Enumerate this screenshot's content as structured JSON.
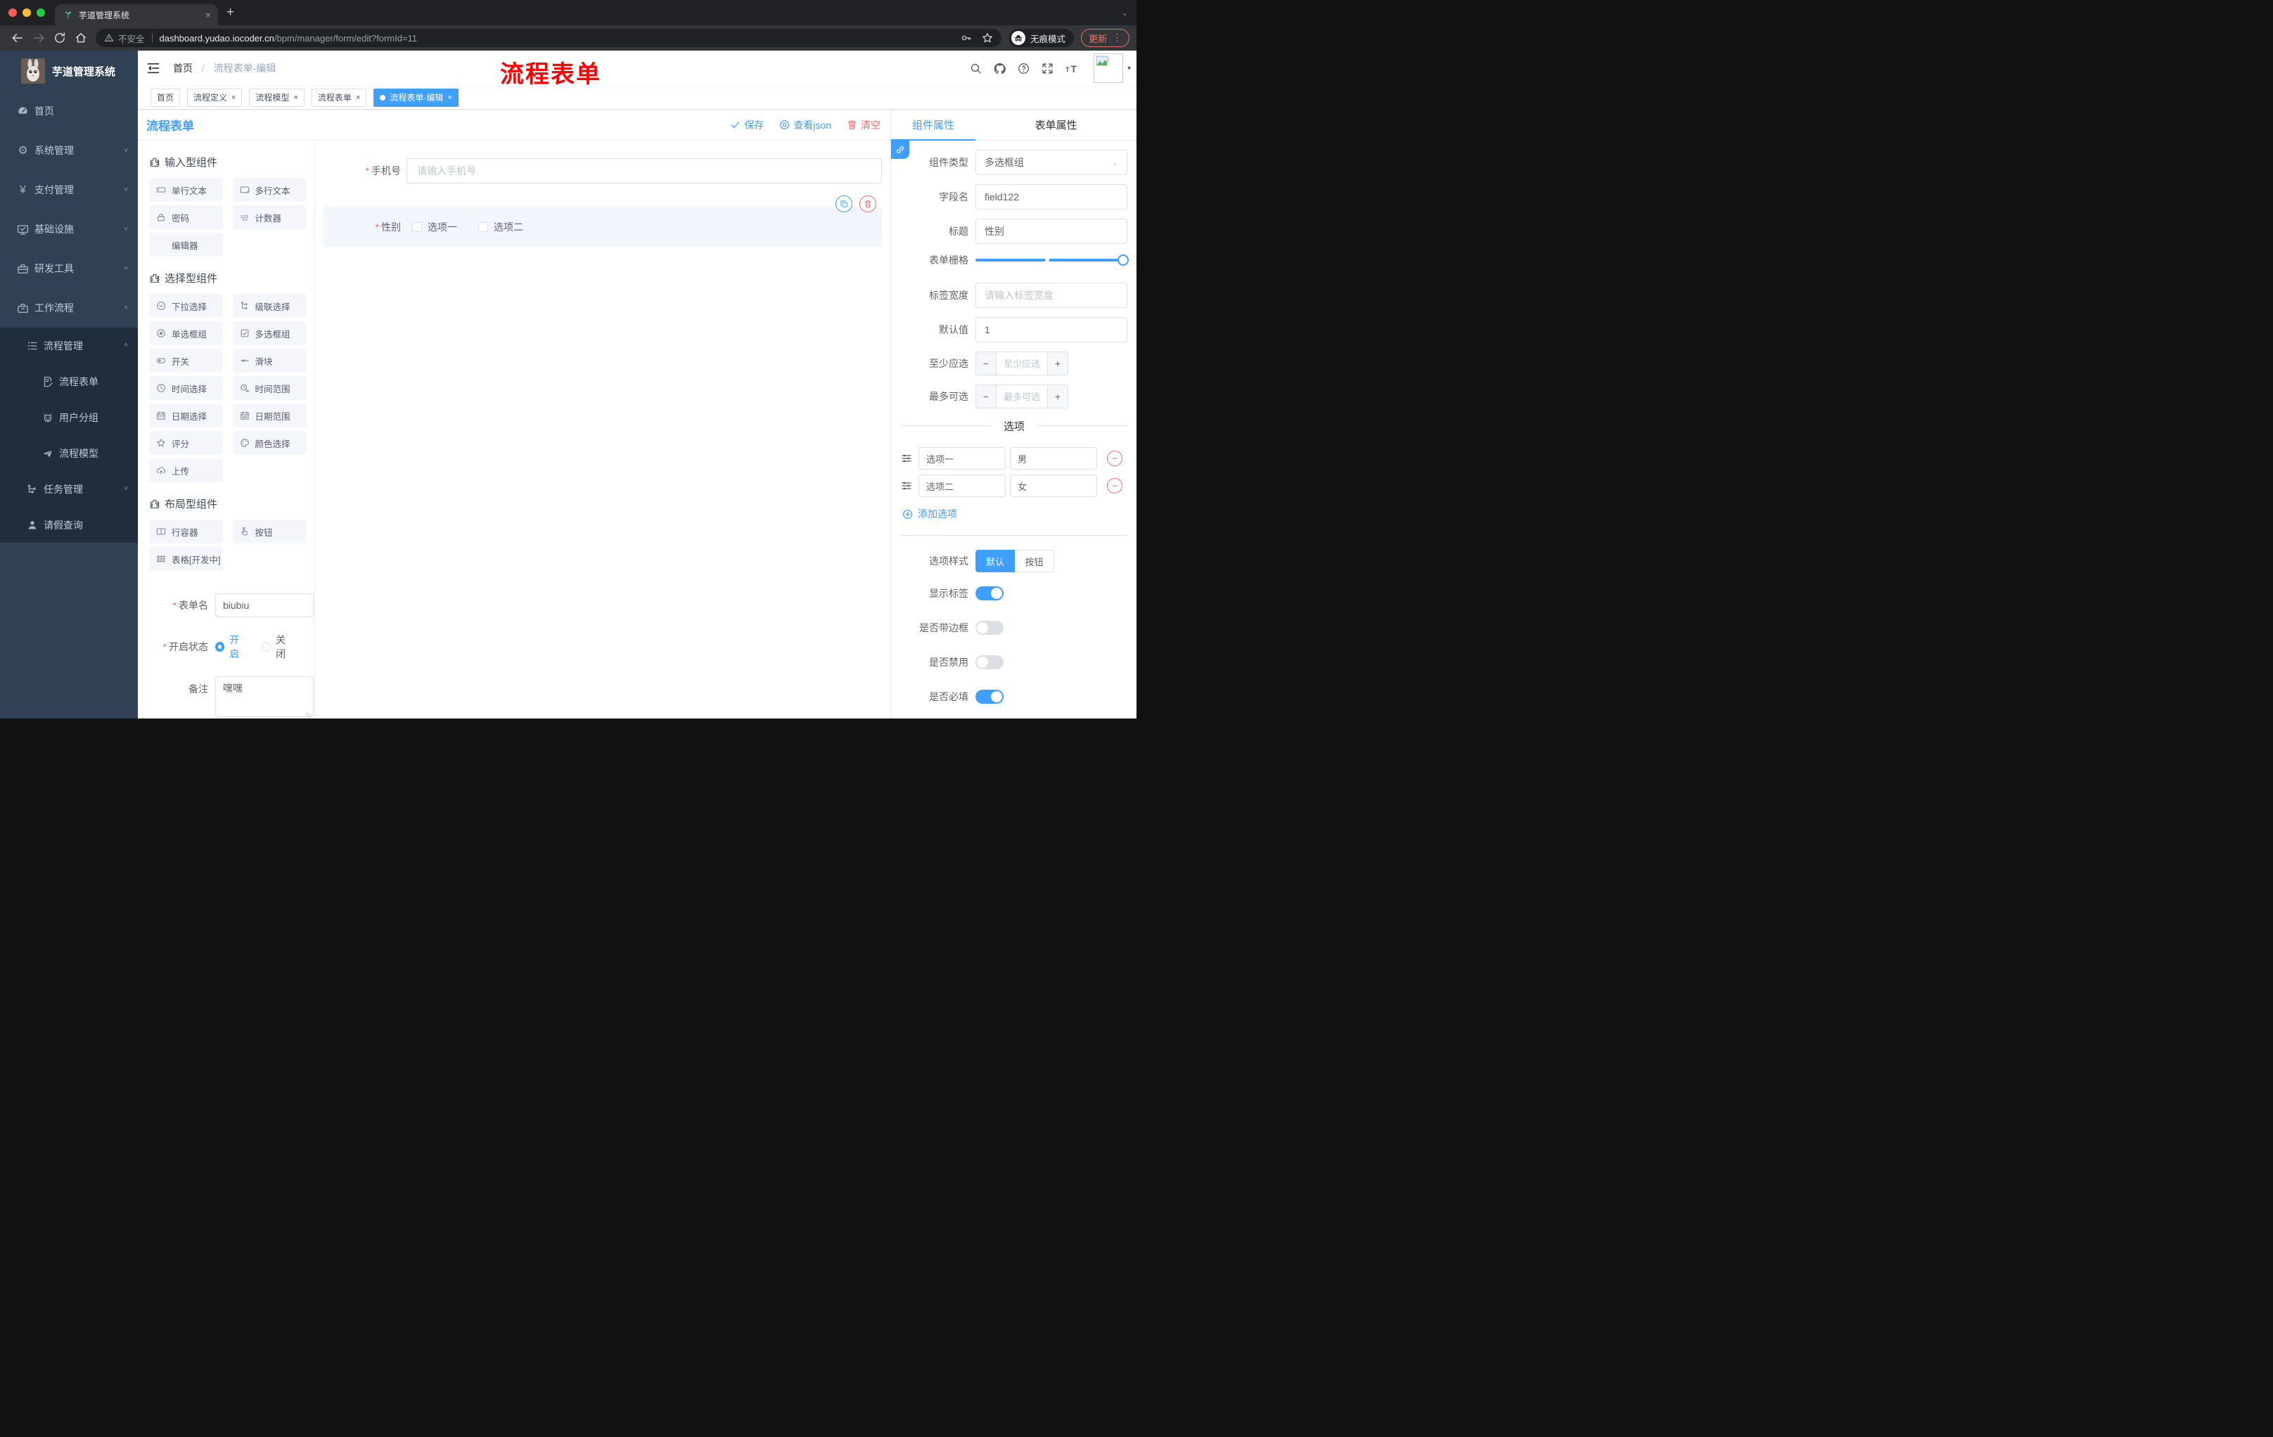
{
  "ui": {
    "close": "×",
    "plus": "+",
    "minus": "−",
    "kebab": "⋮",
    "caret": "▾",
    "strip_caret": "⌄",
    "slash": "/",
    "asterisk": "*",
    "sel_caret": "⌄"
  },
  "colors": {
    "accent": "#409eff",
    "danger": "#f56c6c",
    "sidebar_bg": "#304156",
    "submenu_bg": "#1f2d3d",
    "annotation": "#ff0000",
    "active_tag": "#409eff"
  },
  "browser": {
    "tab_title": "芋道管理系统",
    "security_label": "不安全",
    "url_host": "dashboard.yudao.iocoder.cn",
    "url_path": "/bpm/manager/form/edit?formId=11",
    "incognito_label": "无痕模式",
    "update_label": "更新"
  },
  "header": {
    "breadcrumb_home": "首页",
    "breadcrumb_current": "流程表单-编辑",
    "annotation": "流程表单"
  },
  "sidebar": {
    "logo_title": "芋道管理系统",
    "items": [
      {
        "label": "首页",
        "icon": "dashboard-icon"
      },
      {
        "label": "系统管理",
        "icon": "gear-icon"
      },
      {
        "label": "支付管理",
        "icon": "yen-icon"
      },
      {
        "label": "基础设施",
        "icon": "monitor-icon"
      },
      {
        "label": "研发工具",
        "icon": "toolbox-icon"
      },
      {
        "label": "工作流程",
        "icon": "briefcase-icon"
      }
    ],
    "submenu": [
      {
        "label": "流程管理",
        "icon": "list-tree-icon"
      },
      {
        "label": "流程表单",
        "icon": "form-edit-icon"
      },
      {
        "label": "用户分组",
        "icon": "robot-icon"
      },
      {
        "label": "流程模型",
        "icon": "paper-plane-icon"
      },
      {
        "label": "任务管理",
        "icon": "org-tree-icon"
      },
      {
        "label": "请假查询",
        "icon": "user-icon"
      }
    ]
  },
  "tags": [
    {
      "label": "首页",
      "closable": false,
      "active": false
    },
    {
      "label": "流程定义",
      "closable": true,
      "active": false
    },
    {
      "label": "流程模型",
      "closable": true,
      "active": false
    },
    {
      "label": "流程表单",
      "closable": true,
      "active": false
    },
    {
      "label": "流程表单-编辑",
      "closable": true,
      "active": true
    }
  ],
  "board": {
    "title": "流程表单",
    "save_label": "保存",
    "view_json_label": "查看json",
    "clear_label": "清空"
  },
  "palette": {
    "sections": [
      {
        "title": "输入型组件",
        "items": [
          {
            "label": "单行文本"
          },
          {
            "label": "多行文本"
          },
          {
            "label": "密码"
          },
          {
            "label": "计数器"
          },
          {
            "label": "编辑器"
          }
        ]
      },
      {
        "title": "选择型组件",
        "items": [
          {
            "label": "下拉选择"
          },
          {
            "label": "级联选择"
          },
          {
            "label": "单选框组"
          },
          {
            "label": "多选框组"
          },
          {
            "label": "开关"
          },
          {
            "label": "滑块"
          },
          {
            "label": "时间选择"
          },
          {
            "label": "时间范围"
          },
          {
            "label": "日期选择"
          },
          {
            "label": "日期范围"
          },
          {
            "label": "评分"
          },
          {
            "label": "颜色选择"
          },
          {
            "label": "上传"
          }
        ]
      },
      {
        "title": "布局型组件",
        "items": [
          {
            "label": "行容器"
          },
          {
            "label": "按钮"
          },
          {
            "label": "表格[开发中]"
          }
        ]
      }
    ]
  },
  "leftform": {
    "name_label": "表单名",
    "name_value": "biubiu",
    "status_label": "开启状态",
    "status_on": "开启",
    "status_off": "关闭",
    "remark_label": "备注",
    "remark_value": "嘿嘿"
  },
  "canvas": {
    "phone_label": "手机号",
    "phone_placeholder": "请输入手机号",
    "gender_label": "性别",
    "gender_opt1": "选项一",
    "gender_opt2": "选项二"
  },
  "panel": {
    "tab_component": "组件属性",
    "tab_form": "表单属性",
    "type_label": "组件类型",
    "type_value": "多选框组",
    "field_label": "字段名",
    "field_value": "field122",
    "title_label": "标题",
    "title_value": "性别",
    "grid_label": "表单栅格",
    "width_label": "标签宽度",
    "width_placeholder": "请输入标签宽度",
    "default_label": "默认值",
    "default_value": "1",
    "min_label": "至少应选",
    "min_placeholder": "至少应选",
    "max_label": "最多可选",
    "max_placeholder": "最多可选",
    "options_title": "选项",
    "options": [
      {
        "label": "选项一",
        "value": "男"
      },
      {
        "label": "选项二",
        "value": "女"
      }
    ],
    "add_option": "添加选项",
    "style_label": "选项样式",
    "style_default": "默认",
    "style_button": "按钮",
    "sw_show_label": "显示标签",
    "sw_border_label": "是否带边框",
    "sw_disabled_label": "是否禁用",
    "sw_required_label": "是否必填"
  }
}
